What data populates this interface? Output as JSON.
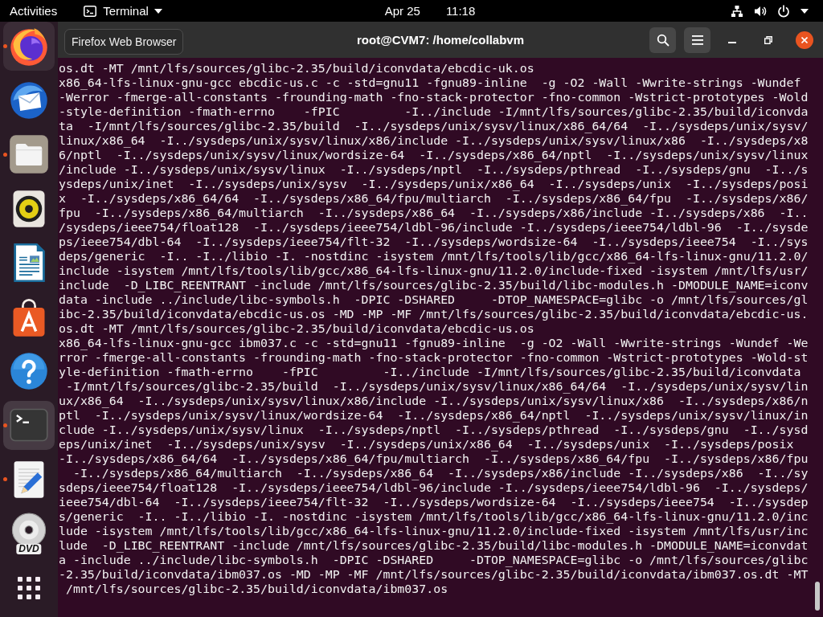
{
  "top_bar": {
    "activities": "Activities",
    "app_menu": "Terminal",
    "clock": {
      "date": "Apr 25",
      "time": "11:18"
    }
  },
  "dock": {
    "items": [
      {
        "kind": "browser",
        "running": true,
        "selected": false,
        "hovered": true
      },
      {
        "kind": "mail",
        "running": false,
        "selected": false,
        "hovered": false
      },
      {
        "kind": "files",
        "running": true,
        "selected": false,
        "hovered": false
      },
      {
        "kind": "music",
        "running": false,
        "selected": false,
        "hovered": false
      },
      {
        "kind": "writer",
        "running": false,
        "selected": false,
        "hovered": false
      },
      {
        "kind": "store",
        "running": false,
        "selected": false,
        "hovered": false
      },
      {
        "kind": "help",
        "running": false,
        "selected": false,
        "hovered": false
      },
      {
        "kind": "terminal",
        "running": true,
        "selected": true,
        "hovered": false
      },
      {
        "kind": "editor",
        "running": true,
        "selected": false,
        "hovered": false
      },
      {
        "kind": "disc",
        "label": "DVD",
        "running": false,
        "selected": false,
        "hovered": false
      },
      {
        "kind": "apps",
        "running": false,
        "selected": false,
        "hovered": false
      }
    ]
  },
  "tooltip": {
    "text": "Firefox Web Browser"
  },
  "terminal": {
    "title": "root@CVM7: /home/collabvm",
    "lines": [
      "os.dt -MT /mnt/lfs/sources/glibc-2.35/build/iconvdata/ebcdic-uk.os",
      "x86_64-lfs-linux-gnu-gcc ebcdic-us.c -c -std=gnu11 -fgnu89-inline  -g -O2 -Wall -Wwrite-strings -Wundef",
      "-Werror -fmerge-all-constants -frounding-math -fno-stack-protector -fno-common -Wstrict-prototypes -Wold",
      "-style-definition -fmath-errno    -fPIC         -I../include -I/mnt/lfs/sources/glibc-2.35/build/iconvda",
      "ta  -I/mnt/lfs/sources/glibc-2.35/build  -I../sysdeps/unix/sysv/linux/x86_64/64  -I../sysdeps/unix/sysv/",
      "linux/x86_64  -I../sysdeps/unix/sysv/linux/x86/include -I../sysdeps/unix/sysv/linux/x86  -I../sysdeps/x8",
      "6/nptl  -I../sysdeps/unix/sysv/linux/wordsize-64  -I../sysdeps/x86_64/nptl  -I../sysdeps/unix/sysv/linux",
      "/include -I../sysdeps/unix/sysv/linux  -I../sysdeps/nptl  -I../sysdeps/pthread  -I../sysdeps/gnu  -I../s",
      "ysdeps/unix/inet  -I../sysdeps/unix/sysv  -I../sysdeps/unix/x86_64  -I../sysdeps/unix  -I../sysdeps/posi",
      "x  -I../sysdeps/x86_64/64  -I../sysdeps/x86_64/fpu/multiarch  -I../sysdeps/x86_64/fpu  -I../sysdeps/x86/",
      "fpu  -I../sysdeps/x86_64/multiarch  -I../sysdeps/x86_64  -I../sysdeps/x86/include -I../sysdeps/x86  -I..",
      "/sysdeps/ieee754/float128  -I../sysdeps/ieee754/ldbl-96/include -I../sysdeps/ieee754/ldbl-96  -I../sysde",
      "ps/ieee754/dbl-64  -I../sysdeps/ieee754/flt-32  -I../sysdeps/wordsize-64  -I../sysdeps/ieee754  -I../sys",
      "deps/generic  -I.. -I../libio -I. -nostdinc -isystem /mnt/lfs/tools/lib/gcc/x86_64-lfs-linux-gnu/11.2.0/",
      "include -isystem /mnt/lfs/tools/lib/gcc/x86_64-lfs-linux-gnu/11.2.0/include-fixed -isystem /mnt/lfs/usr/",
      "include  -D_LIBC_REENTRANT -include /mnt/lfs/sources/glibc-2.35/build/libc-modules.h -DMODULE_NAME=iconv",
      "data -include ../include/libc-symbols.h  -DPIC -DSHARED     -DTOP_NAMESPACE=glibc -o /mnt/lfs/sources/gl",
      "ibc-2.35/build/iconvdata/ebcdic-us.os -MD -MP -MF /mnt/lfs/sources/glibc-2.35/build/iconvdata/ebcdic-us.",
      "os.dt -MT /mnt/lfs/sources/glibc-2.35/build/iconvdata/ebcdic-us.os",
      "x86_64-lfs-linux-gnu-gcc ibm037.c -c -std=gnu11 -fgnu89-inline  -g -O2 -Wall -Wwrite-strings -Wundef -We",
      "rror -fmerge-all-constants -frounding-math -fno-stack-protector -fno-common -Wstrict-prototypes -Wold-st",
      "yle-definition -fmath-errno    -fPIC         -I../include -I/mnt/lfs/sources/glibc-2.35/build/iconvdata",
      " -I/mnt/lfs/sources/glibc-2.35/build  -I../sysdeps/unix/sysv/linux/x86_64/64  -I../sysdeps/unix/sysv/lin",
      "ux/x86_64  -I../sysdeps/unix/sysv/linux/x86/include -I../sysdeps/unix/sysv/linux/x86  -I../sysdeps/x86/n",
      "ptl  -I../sysdeps/unix/sysv/linux/wordsize-64  -I../sysdeps/x86_64/nptl  -I../sysdeps/unix/sysv/linux/in",
      "clude -I../sysdeps/unix/sysv/linux  -I../sysdeps/nptl  -I../sysdeps/pthread  -I../sysdeps/gnu  -I../sysd",
      "eps/unix/inet  -I../sysdeps/unix/sysv  -I../sysdeps/unix/x86_64  -I../sysdeps/unix  -I../sysdeps/posix",
      "-I../sysdeps/x86_64/64  -I../sysdeps/x86_64/fpu/multiarch  -I../sysdeps/x86_64/fpu  -I../sysdeps/x86/fpu",
      "  -I../sysdeps/x86_64/multiarch  -I../sysdeps/x86_64  -I../sysdeps/x86/include -I../sysdeps/x86  -I../sy",
      "sdeps/ieee754/float128  -I../sysdeps/ieee754/ldbl-96/include -I../sysdeps/ieee754/ldbl-96  -I../sysdeps/",
      "ieee754/dbl-64  -I../sysdeps/ieee754/flt-32  -I../sysdeps/wordsize-64  -I../sysdeps/ieee754  -I../sysdep",
      "s/generic  -I.. -I../libio -I. -nostdinc -isystem /mnt/lfs/tools/lib/gcc/x86_64-lfs-linux-gnu/11.2.0/inc",
      "lude -isystem /mnt/lfs/tools/lib/gcc/x86_64-lfs-linux-gnu/11.2.0/include-fixed -isystem /mnt/lfs/usr/inc",
      "lude  -D_LIBC_REENTRANT -include /mnt/lfs/sources/glibc-2.35/build/libc-modules.h -DMODULE_NAME=iconvdat",
      "a -include ../include/libc-symbols.h  -DPIC -DSHARED     -DTOP_NAMESPACE=glibc -o /mnt/lfs/sources/glibc",
      "-2.35/build/iconvdata/ibm037.os -MD -MP -MF /mnt/lfs/sources/glibc-2.35/build/iconvdata/ibm037.os.dt -MT",
      " /mnt/lfs/sources/glibc-2.35/build/iconvdata/ibm037.os"
    ]
  }
}
